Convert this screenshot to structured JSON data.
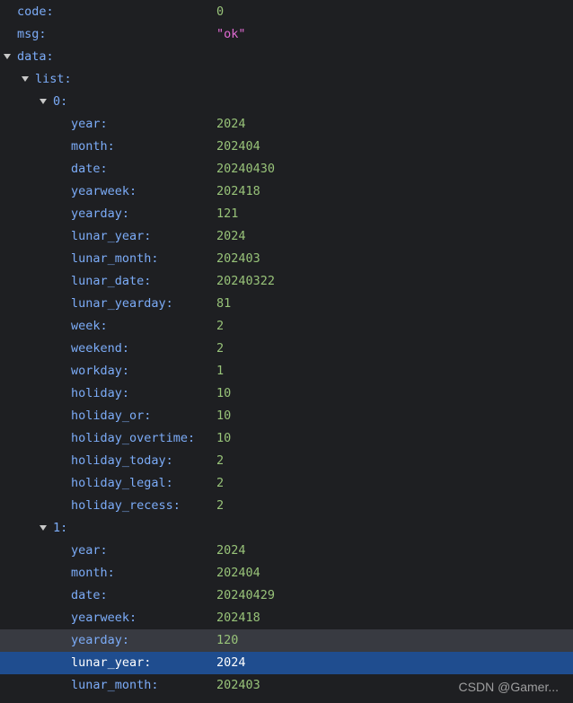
{
  "tree": {
    "code": {
      "key": "code:",
      "value": "0"
    },
    "msg": {
      "key": "msg:",
      "value": "\"ok\""
    },
    "data_key": "data:",
    "list_key": "list:",
    "item0_key": "0:",
    "item1_key": "1:",
    "item0": [
      {
        "key": "year:",
        "value": "2024"
      },
      {
        "key": "month:",
        "value": "202404"
      },
      {
        "key": "date:",
        "value": "20240430"
      },
      {
        "key": "yearweek:",
        "value": "202418"
      },
      {
        "key": "yearday:",
        "value": "121"
      },
      {
        "key": "lunar_year:",
        "value": "2024"
      },
      {
        "key": "lunar_month:",
        "value": "202403"
      },
      {
        "key": "lunar_date:",
        "value": "20240322"
      },
      {
        "key": "lunar_yearday:",
        "value": "81"
      },
      {
        "key": "week:",
        "value": "2"
      },
      {
        "key": "weekend:",
        "value": "2"
      },
      {
        "key": "workday:",
        "value": "1"
      },
      {
        "key": "holiday:",
        "value": "10"
      },
      {
        "key": "holiday_or:",
        "value": "10"
      },
      {
        "key": "holiday_overtime:",
        "value": "10"
      },
      {
        "key": "holiday_today:",
        "value": "2"
      },
      {
        "key": "holiday_legal:",
        "value": "2"
      },
      {
        "key": "holiday_recess:",
        "value": "2"
      }
    ],
    "item1": [
      {
        "key": "year:",
        "value": "2024"
      },
      {
        "key": "month:",
        "value": "202404"
      },
      {
        "key": "date:",
        "value": "20240429"
      },
      {
        "key": "yearweek:",
        "value": "202418"
      },
      {
        "key": "yearday:",
        "value": "120"
      },
      {
        "key": "lunar_year:",
        "value": "2024"
      },
      {
        "key": "lunar_month:",
        "value": "202403"
      }
    ]
  },
  "watermark": "CSDN @Gamer..."
}
